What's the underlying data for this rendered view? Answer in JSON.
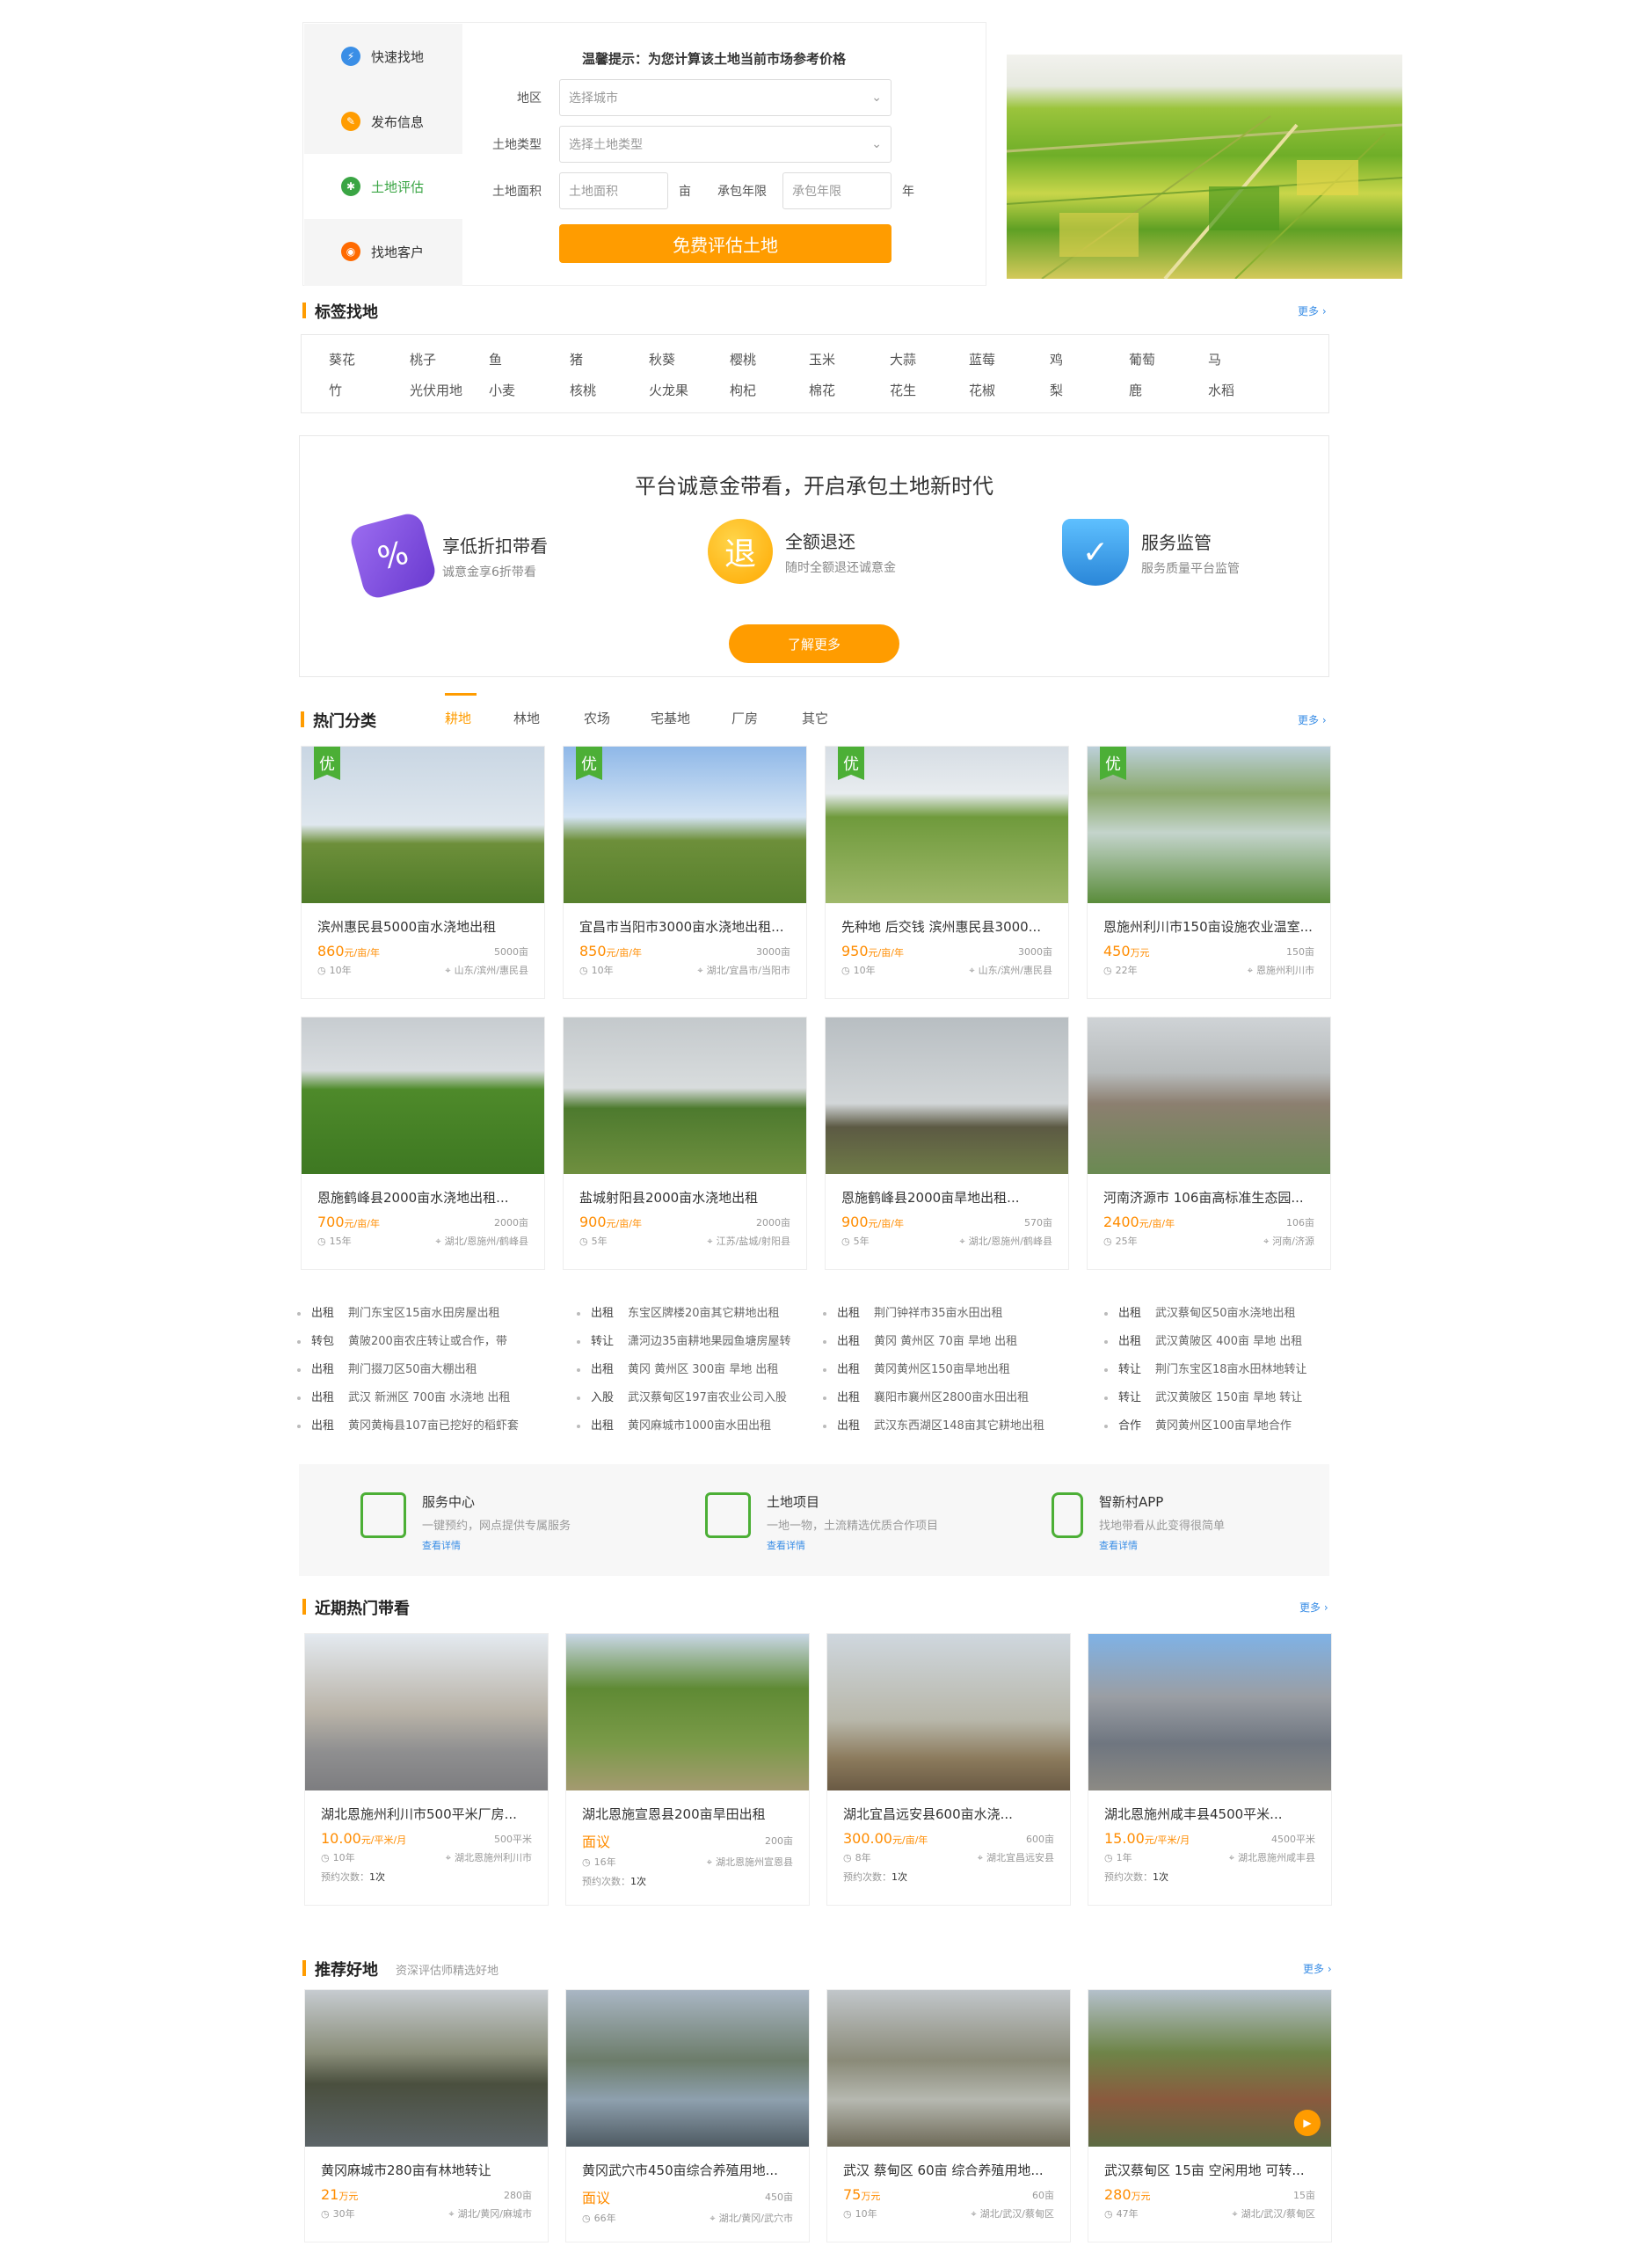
{
  "search_widget": {
    "nav": [
      {
        "label": "快速找地",
        "icon": "lightning-icon",
        "color": "#3a8ee6"
      },
      {
        "label": "发布信息",
        "icon": "edit-icon",
        "color": "#ff9c00"
      },
      {
        "label": "土地评估",
        "icon": "assess-icon",
        "color": "#3aa544",
        "active": true
      },
      {
        "label": "找地客户",
        "icon": "customer-icon",
        "color": "#ff6a00"
      }
    ],
    "tip": "温馨提示：为您计算该土地当前市场参考价格",
    "region_label": "地区",
    "region_placeholder": "选择城市",
    "type_label": "土地类型",
    "type_placeholder": "选择土地类型",
    "area_label": "土地面积",
    "area_placeholder": "土地面积",
    "area_unit": "亩",
    "term_label": "承包年限",
    "term_placeholder": "承包年限",
    "term_unit": "年",
    "submit_label": "免费评估土地"
  },
  "tags_section": {
    "title": "标签找地",
    "more": "更多",
    "row1": [
      "葵花",
      "桃子",
      "鱼",
      "猪",
      "秋葵",
      "樱桃",
      "玉米",
      "大蒜",
      "蓝莓",
      "鸡",
      "葡萄",
      "马"
    ],
    "row2": [
      "竹",
      "光伏用地",
      "小麦",
      "核桃",
      "火龙果",
      "枸杞",
      "棉花",
      "花生",
      "花椒",
      "梨",
      "鹿",
      "水稻"
    ]
  },
  "promo": {
    "title": "平台诚意金带看，开启承包土地新时代",
    "features": [
      {
        "title": "享低折扣带看",
        "sub": "诚意金享6折带看",
        "icon": "discount-tag-icon",
        "color": "#7b4cd8"
      },
      {
        "title": "全额退还",
        "sub": "随时全额退还诚意金",
        "icon": "refund-coin-icon",
        "color": "#ffb400",
        "glyph": "退"
      },
      {
        "title": "服务监管",
        "sub": "服务质量平台监管",
        "icon": "shield-check-icon",
        "color": "#3a9ee8"
      }
    ],
    "button": "了解更多"
  },
  "hot": {
    "title": "热门分类",
    "tabs": [
      "耕地",
      "林地",
      "农场",
      "宅基地",
      "厂房",
      "其它"
    ],
    "more": "更多",
    "badge": "优",
    "cards": [
      {
        "title": "滨州惠民县5000亩水浇地出租",
        "price": "860",
        "unit": "元/亩/年",
        "area": "5000亩",
        "years": "10年",
        "loc": "山东/滨州/惠民县",
        "badge": true
      },
      {
        "title": "宜昌市当阳市3000亩水浇地出租...",
        "price": "850",
        "unit": "元/亩/年",
        "area": "3000亩",
        "years": "10年",
        "loc": "湖北/宜昌市/当阳市",
        "badge": true
      },
      {
        "title": "先种地 后交钱 滨州惠民县3000...",
        "price": "950",
        "unit": "元/亩/年",
        "area": "3000亩",
        "years": "10年",
        "loc": "山东/滨州/惠民县",
        "badge": true
      },
      {
        "title": "恩施州利川市150亩设施农业温室...",
        "price": "450",
        "unit": "万元",
        "area": "150亩",
        "years": "22年",
        "loc": "恩施州利川市",
        "badge": true
      },
      {
        "title": "恩施鹤峰县2000亩水浇地出租...",
        "price": "700",
        "unit": "元/亩/年",
        "area": "2000亩",
        "years": "15年",
        "loc": "湖北/恩施州/鹤峰县",
        "badge": false
      },
      {
        "title": "盐城射阳县2000亩水浇地出租",
        "price": "900",
        "unit": "元/亩/年",
        "area": "2000亩",
        "years": "5年",
        "loc": "江苏/盐城/射阳县",
        "badge": false
      },
      {
        "title": "恩施鹤峰县2000亩旱地出租...",
        "price": "900",
        "unit": "元/亩/年",
        "area": "570亩",
        "years": "5年",
        "loc": "湖北/恩施州/鹤峰县",
        "badge": false
      },
      {
        "title": "河南济源市 106亩高标准生态园...",
        "price": "2400",
        "unit": "元/亩/年",
        "area": "106亩",
        "years": "25年",
        "loc": "河南/济源",
        "badge": false
      }
    ]
  },
  "listings": [
    [
      {
        "type": "出租",
        "text": "荆门东宝区15亩水田房屋出租"
      },
      {
        "type": "转包",
        "text": "黄陂200亩农庄转让或合作，带"
      },
      {
        "type": "出租",
        "text": "荆门掇刀区50亩大棚出租"
      },
      {
        "type": "出租",
        "text": "武汉 新洲区 700亩 水浇地 出租"
      },
      {
        "type": "出租",
        "text": "黄冈黄梅县107亩已挖好的稻虾套"
      }
    ],
    [
      {
        "type": "出租",
        "text": "东宝区牌楼20亩其它耕地出租"
      },
      {
        "type": "转让",
        "text": "潇河边35亩耕地果园鱼塘房屋转"
      },
      {
        "type": "出租",
        "text": "黄冈 黄州区 300亩 旱地 出租"
      },
      {
        "type": "入股",
        "text": "武汉蔡甸区197亩农业公司入股"
      },
      {
        "type": "出租",
        "text": "黄冈麻城市1000亩水田出租"
      }
    ],
    [
      {
        "type": "出租",
        "text": "荆门钟祥市35亩水田出租"
      },
      {
        "type": "出租",
        "text": "黄冈 黄州区 70亩 旱地 出租"
      },
      {
        "type": "出租",
        "text": "黄冈黄州区150亩旱地出租"
      },
      {
        "type": "出租",
        "text": "襄阳市襄州区2800亩水田出租"
      },
      {
        "type": "出租",
        "text": "武汉东西湖区148亩其它耕地出租"
      }
    ],
    [
      {
        "type": "出租",
        "text": "武汉蔡甸区50亩水浇地出租"
      },
      {
        "type": "出租",
        "text": "武汉黄陂区 400亩 旱地 出租"
      },
      {
        "type": "转让",
        "text": "荆门东宝区18亩水田林地转让"
      },
      {
        "type": "转让",
        "text": "武汉黄陂区 150亩 旱地 转让"
      },
      {
        "type": "合作",
        "text": "黄冈黄州区100亩旱地合作"
      }
    ]
  ],
  "services": [
    {
      "title": "服务中心",
      "sub": "一键预约，网点提供专属服务",
      "link": "查看详情",
      "icon": "building-icon"
    },
    {
      "title": "土地项目",
      "sub": "一地一物，土流精选优质合作项目",
      "link": "查看详情",
      "icon": "project-doc-icon"
    },
    {
      "title": "智新村APP",
      "sub": "找地带看从此变得很简单",
      "link": "查看详情",
      "icon": "phone-app-icon"
    }
  ],
  "recent": {
    "title": "近期热门带看",
    "more": "更多",
    "cards": [
      {
        "title": "湖北恩施州利川市500平米厂房...",
        "price": "10.00",
        "unit": "元/平米/月",
        "area": "500平米",
        "years": "10年",
        "loc": "湖北恩施州利川市",
        "visits_label": "预约次数：",
        "visits": "1次"
      },
      {
        "title": "湖北恩施宣恩县200亩旱田出租",
        "price": "面议",
        "unit": "",
        "area": "200亩",
        "years": "16年",
        "loc": "湖北恩施州宣恩县",
        "visits_label": "预约次数：",
        "visits": "1次"
      },
      {
        "title": "湖北宜昌远安县600亩水浇...",
        "price": "300.00",
        "unit": "元/亩/年",
        "area": "600亩",
        "years": "8年",
        "loc": "湖北宜昌远安县",
        "visits_label": "预约次数：",
        "visits": "1次"
      },
      {
        "title": "湖北恩施州咸丰县4500平米...",
        "price": "15.00",
        "unit": "元/平米/月",
        "area": "4500平米",
        "years": "1年",
        "loc": "湖北恩施州咸丰县",
        "visits_label": "预约次数：",
        "visits": "1次"
      }
    ]
  },
  "recommend": {
    "title": "推荐好地",
    "subtitle": "资深评估师精选好地",
    "more": "更多",
    "cards": [
      {
        "title": "黄冈麻城市280亩有林地转让",
        "price": "21",
        "unit": "万元",
        "area": "280亩",
        "years": "30年",
        "loc": "湖北/黄冈/麻城市"
      },
      {
        "title": "黄冈武穴市450亩综合养殖用地...",
        "price": "面议",
        "unit": "",
        "area": "450亩",
        "years": "66年",
        "loc": "湖北/黄冈/武穴市"
      },
      {
        "title": "武汉 蔡甸区 60亩 综合养殖用地...",
        "price": "75",
        "unit": "万元",
        "area": "60亩",
        "years": "10年",
        "loc": "湖北/武汉/蔡甸区"
      },
      {
        "title": "武汉蔡甸区 15亩 空闲用地 可转...",
        "price": "280",
        "unit": "万元",
        "area": "15亩",
        "years": "47年",
        "loc": "湖北/武汉/蔡甸区"
      }
    ]
  },
  "colors": {
    "accent": "#ff9c00",
    "green": "#4caf36",
    "link": "#3a8ee6"
  }
}
